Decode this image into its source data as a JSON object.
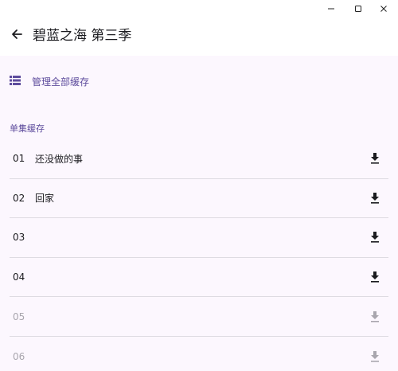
{
  "window": {
    "minimize_icon": "minimize-icon",
    "maximize_icon": "maximize-icon",
    "close_icon": "close-icon"
  },
  "header": {
    "back_icon": "arrow-left-icon",
    "title": "碧蓝之海 第三季"
  },
  "manage": {
    "icon": "list-icon",
    "label": "管理全部缓存"
  },
  "section": {
    "label": "单集缓存"
  },
  "episodes": [
    {
      "number": "01",
      "title": "还没做的事",
      "enabled": true
    },
    {
      "number": "02",
      "title": "回家",
      "enabled": true
    },
    {
      "number": "03",
      "title": "",
      "enabled": true
    },
    {
      "number": "04",
      "title": "",
      "enabled": true
    },
    {
      "number": "05",
      "title": "",
      "enabled": false
    },
    {
      "number": "06",
      "title": "",
      "enabled": false
    }
  ],
  "colors": {
    "accent": "#5e4c9d",
    "background": "#fcf7fe",
    "divider": "#dedbe2",
    "disabled": "#a9a6ae"
  }
}
